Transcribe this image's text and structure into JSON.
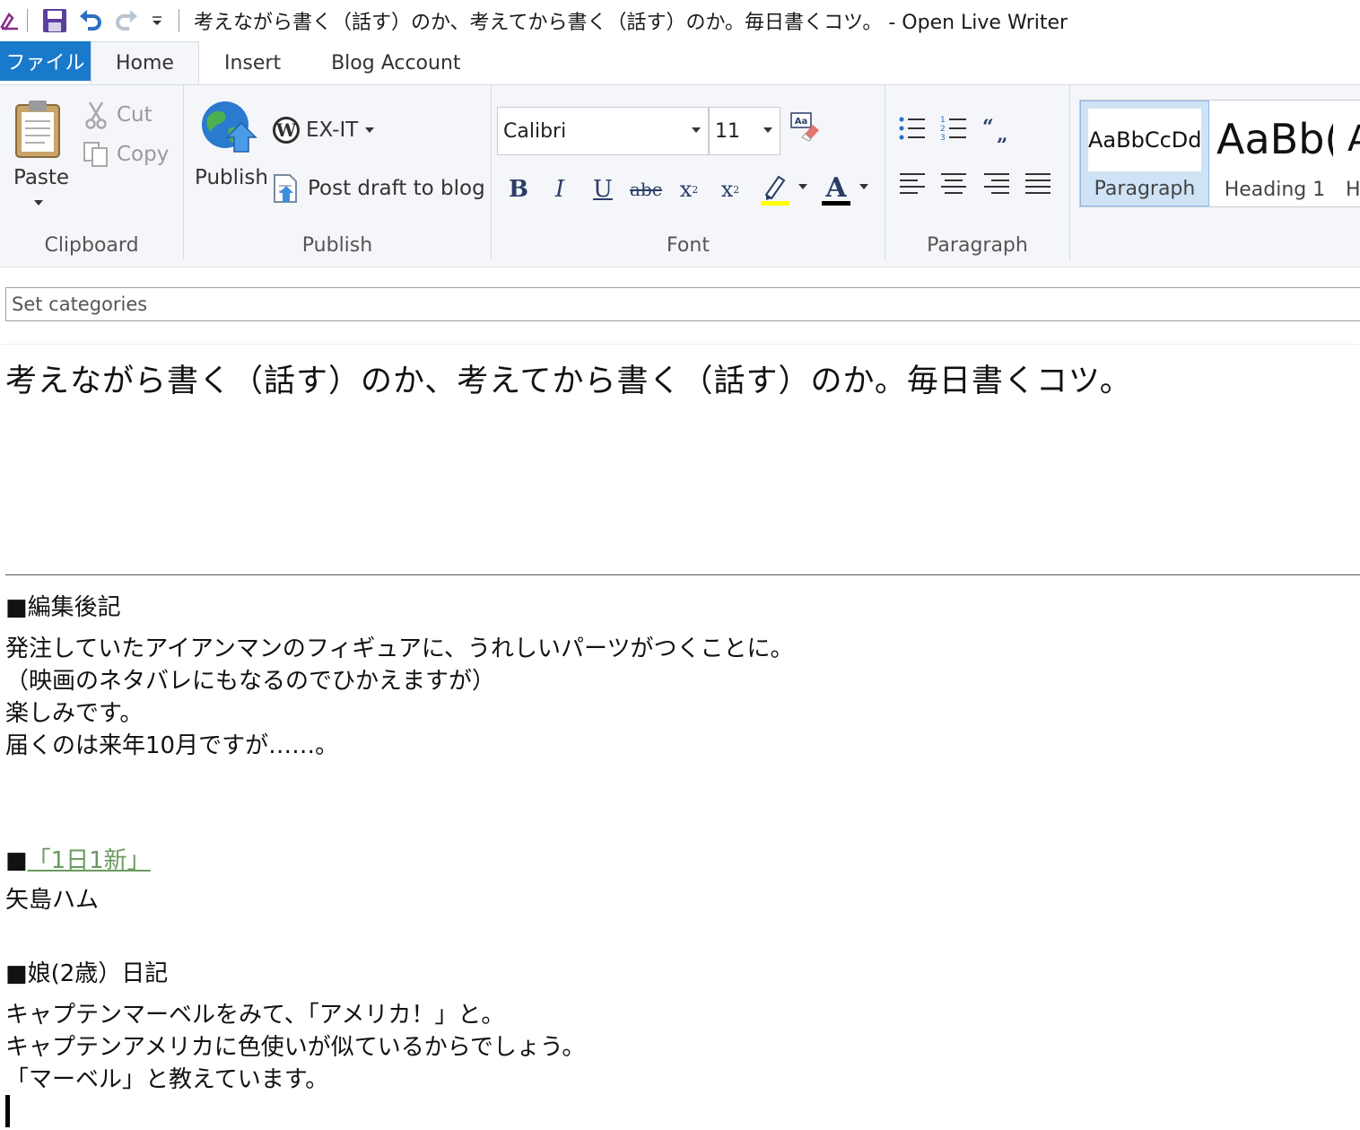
{
  "window": {
    "title": "考えながら書く（話す）のか、考えてから書く（話す）のか。毎日書くコツ。 - Open Live Writer"
  },
  "tabs": [
    {
      "label": "ファイル"
    },
    {
      "label": "Home"
    },
    {
      "label": "Insert"
    },
    {
      "label": "Blog Account"
    }
  ],
  "ribbon": {
    "clipboard": {
      "group_label": "Clipboard",
      "paste": "Paste",
      "cut": "Cut",
      "copy": "Copy"
    },
    "publish": {
      "group_label": "Publish",
      "publish": "Publish",
      "blog_name": "EX-IT",
      "post_draft": "Post draft to blog"
    },
    "font": {
      "group_label": "Font",
      "font_family": "Calibri",
      "font_size": "11",
      "highlight_color": "#ffff00",
      "font_color": "#000000"
    },
    "paragraph": {
      "group_label": "Paragraph"
    },
    "styles": [
      {
        "preview": "AaBbCcDdE",
        "label": "Paragraph",
        "selected": true
      },
      {
        "preview": "AaBb(",
        "label": "Heading 1",
        "selected": false
      },
      {
        "preview": "A",
        "label": "H",
        "selected": false
      }
    ]
  },
  "categories": {
    "placeholder": "Set categories"
  },
  "post": {
    "title": "考えながら書く（話す）のか、考えてから書く（話す）のか。毎日書くコツ。",
    "lines": {
      "afterword_heading": "■編集後記",
      "afterword_1": "発注していたアイアンマンのフィギュアに、うれしいパーツがつくことに。",
      "afterword_2": "（映画のネタバレにもなるのでひかえますが）",
      "afterword_3": "楽しみです。",
      "afterword_4": "届くのは来年10月ですが……。",
      "daily_bullet": "■",
      "daily_link": "「1日1新」",
      "daily_item": "矢島ハム",
      "diary_heading": "■娘(2歳）日記",
      "diary_1": "キャプテンマーベルをみて、「アメリカ！」と。",
      "diary_2": "キャプテンアメリカに色使いが似ているからでしょう。",
      "diary_3": "「マーベル」と教えています。"
    }
  }
}
